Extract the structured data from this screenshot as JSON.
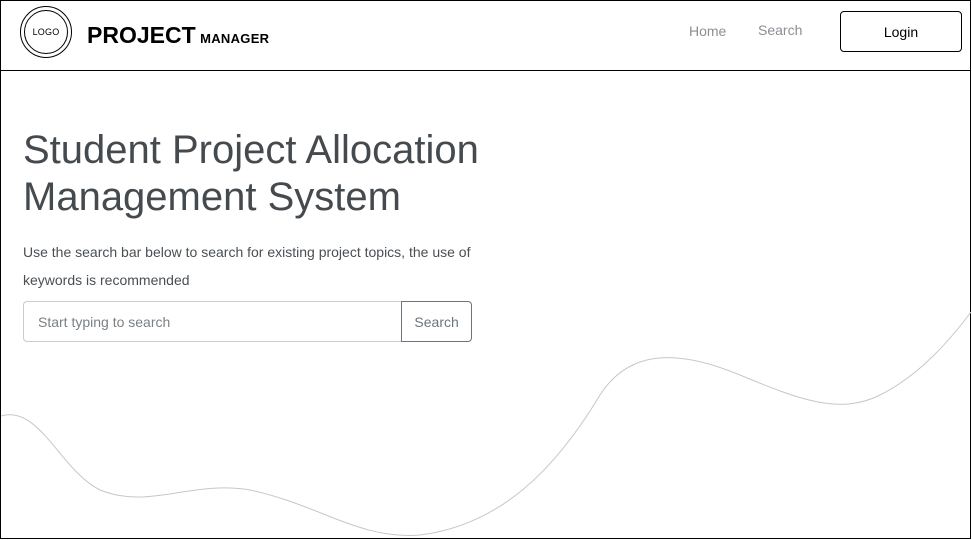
{
  "header": {
    "logo_text": "LOGO",
    "brand_main": "PROJECT",
    "brand_sub": "MANAGER",
    "nav": {
      "home": "Home",
      "search": "Search"
    },
    "login_label": "Login"
  },
  "hero": {
    "title_line1": "Student Project Allocation",
    "title_line2": "Management System",
    "description": "Use the search bar below to search for existing project topics, the use of keywords is recommended",
    "search_placeholder": "Start typing to search",
    "search_button": "Search"
  }
}
